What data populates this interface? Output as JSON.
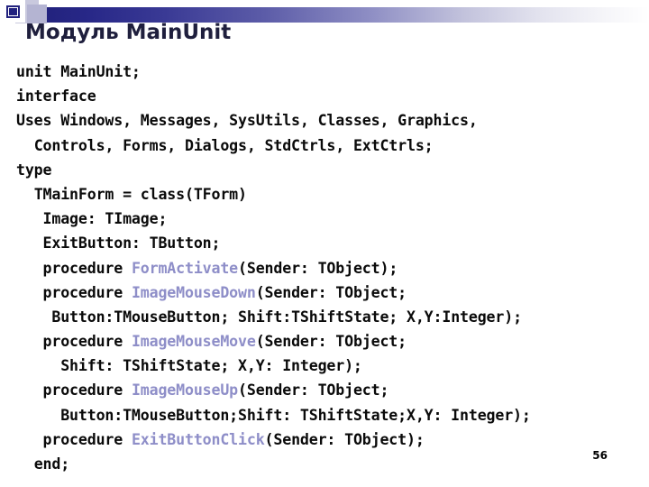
{
  "slide": {
    "title": "Модуль MainUnit",
    "page_number": "56",
    "accent_color": "#23237f",
    "gradient_start": "#20207a",
    "gradient_end": "#ffffff",
    "title_color": "#1f1f3d",
    "code_color": "#0a0a0a",
    "procedure_name_color": "#8e8ec8"
  },
  "code": {
    "language": "pascal",
    "lines": [
      {
        "indent": "",
        "segments": [
          {
            "text": "unit MainUnit;",
            "style": "plain"
          }
        ]
      },
      {
        "indent": "",
        "segments": [
          {
            "text": "interface",
            "style": "plain"
          }
        ]
      },
      {
        "indent": "",
        "segments": [
          {
            "text": "Uses Windows, Messages, SysUtils, Classes, Graphics,",
            "style": "plain"
          }
        ]
      },
      {
        "indent": "  ",
        "segments": [
          {
            "text": "Controls, Forms, Dialogs, StdCtrls, ExtCtrls;",
            "style": "plain"
          }
        ]
      },
      {
        "indent": "",
        "segments": [
          {
            "text": "type",
            "style": "plain"
          }
        ]
      },
      {
        "indent": "  ",
        "segments": [
          {
            "text": "TMainForm = class(TForm)",
            "style": "plain"
          }
        ]
      },
      {
        "indent": "   ",
        "segments": [
          {
            "text": "Image: TImage;",
            "style": "plain"
          }
        ]
      },
      {
        "indent": "   ",
        "segments": [
          {
            "text": "ExitButton: TButton;",
            "style": "plain"
          }
        ]
      },
      {
        "indent": "   ",
        "segments": [
          {
            "text": "procedure ",
            "style": "plain"
          },
          {
            "text": "FormActivate",
            "style": "proc"
          },
          {
            "text": "(Sender: TObject);",
            "style": "plain"
          }
        ]
      },
      {
        "indent": "   ",
        "segments": [
          {
            "text": "procedure ",
            "style": "plain"
          },
          {
            "text": "ImageMouseDown",
            "style": "proc"
          },
          {
            "text": "(Sender: TObject;",
            "style": "plain"
          }
        ]
      },
      {
        "indent": "    ",
        "segments": [
          {
            "text": "Button:TMouseButton; Shift:TShiftState; X,Y:Integer);",
            "style": "plain"
          }
        ]
      },
      {
        "indent": "   ",
        "segments": [
          {
            "text": "procedure ",
            "style": "plain"
          },
          {
            "text": "ImageMouseMove",
            "style": "proc"
          },
          {
            "text": "(Sender: TObject;",
            "style": "plain"
          }
        ]
      },
      {
        "indent": "     ",
        "segments": [
          {
            "text": "Shift: TShiftState; X,Y: Integer);",
            "style": "plain"
          }
        ]
      },
      {
        "indent": "   ",
        "segments": [
          {
            "text": "procedure ",
            "style": "plain"
          },
          {
            "text": "ImageMouseUp",
            "style": "proc"
          },
          {
            "text": "(Sender: TObject;",
            "style": "plain"
          }
        ]
      },
      {
        "indent": "     ",
        "segments": [
          {
            "text": "Button:TMouseButton;Shift: TShiftState;X,Y: Integer);",
            "style": "plain"
          }
        ]
      },
      {
        "indent": "   ",
        "segments": [
          {
            "text": "procedure ",
            "style": "plain"
          },
          {
            "text": "ExitButtonClick",
            "style": "proc"
          },
          {
            "text": "(Sender: TObject);",
            "style": "plain"
          }
        ]
      },
      {
        "indent": "  ",
        "segments": [
          {
            "text": "end;",
            "style": "plain"
          }
        ]
      }
    ]
  }
}
